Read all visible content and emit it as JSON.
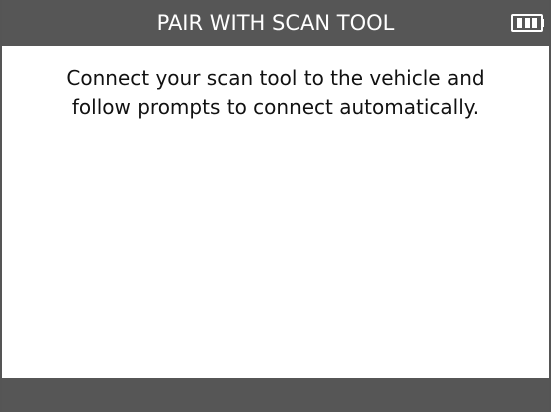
{
  "header": {
    "title": "PAIR WITH SCAN TOOL",
    "battery_icon": "battery-full-icon",
    "battery_level": 1.0,
    "background_color": "#565656",
    "text_color": "#ffffff"
  },
  "body": {
    "message_line_1": "Connect your scan tool to the vehicle and",
    "message_line_2": "follow prompts to connect automatically."
  },
  "footer": {
    "background_color": "#565656"
  }
}
